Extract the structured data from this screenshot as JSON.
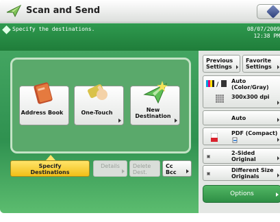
{
  "app": {
    "title": "Scan and Send",
    "title_icon": "scan-send-icon",
    "corner_icon": "diamond-icon"
  },
  "message": {
    "text": "Specify the destinations.",
    "date": "08/07/2009",
    "time": "12:38 PM"
  },
  "destinations": [
    {
      "label": "Address Book",
      "icon": "address-book-icon"
    },
    {
      "label": "One-Touch",
      "icon": "one-touch-icon"
    },
    {
      "label": "New\nDestination",
      "icon": "new-destination-icon"
    }
  ],
  "tabs": {
    "specify": "Specify\nDestinations",
    "details": "Details",
    "delete": "Delete\nDest.",
    "cc_bcc": "Cc\nBcc"
  },
  "settings": {
    "previous": "Previous\nSettings",
    "favorite": "Favorite\nSettings",
    "color_mode": "Auto\n(Color/Gray)",
    "resolution": "300x300 dpi",
    "size": "Auto",
    "file_format": "PDF (Compact)",
    "two_sided": "2-Sided\nOriginal",
    "different_size": "Different Size\nOriginals",
    "options": "Options"
  },
  "colors": {
    "accent_green": "#2f9a4f",
    "active_tab_yellow": "#f2bf17"
  }
}
